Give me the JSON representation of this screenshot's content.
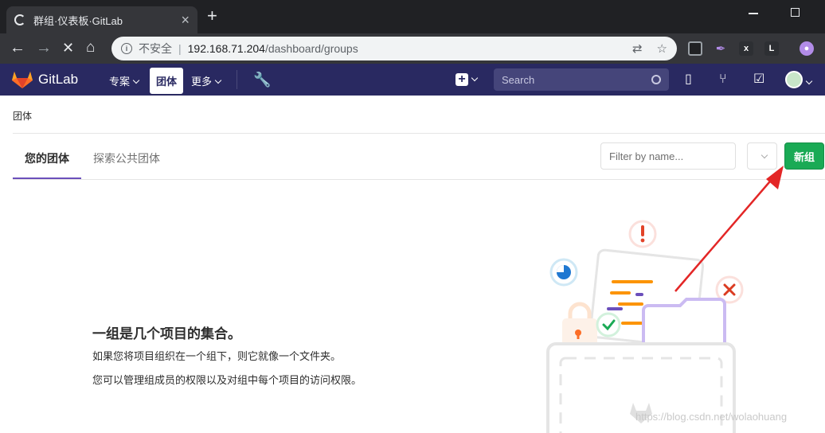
{
  "browser": {
    "tab_title": "群组·仪表板·GitLab",
    "tab_close": "×",
    "new_tab": "+",
    "insecure_label": "不安全",
    "url_separator": "|",
    "url_host": "192.168.71.204",
    "url_path": "/dashboard/groups"
  },
  "header": {
    "brand": "GitLab",
    "nav": [
      "专案",
      "团体",
      "更多"
    ],
    "search_placeholder": "Search"
  },
  "page": {
    "breadcrumb": "团体",
    "tabs": [
      "您的团体",
      "探索公共团体"
    ],
    "filter_placeholder": "Filter by name...",
    "new_group_button": "新组",
    "empty_title": "一组是几个项目的集合。",
    "empty_p1": "如果您将项目组织在一个组下，则它就像一个文件夹。",
    "empty_p2": "您可以管理组成员的权限以及对组中每个项目的访问权限。"
  },
  "watermark": "https://blog.csdn.net/wolaohuang",
  "colors": {
    "header_bg": "#292961",
    "new_button": "#1aaa55",
    "active_tab_underline": "#6b4fbb",
    "annotation_arrow": "#e32626"
  }
}
